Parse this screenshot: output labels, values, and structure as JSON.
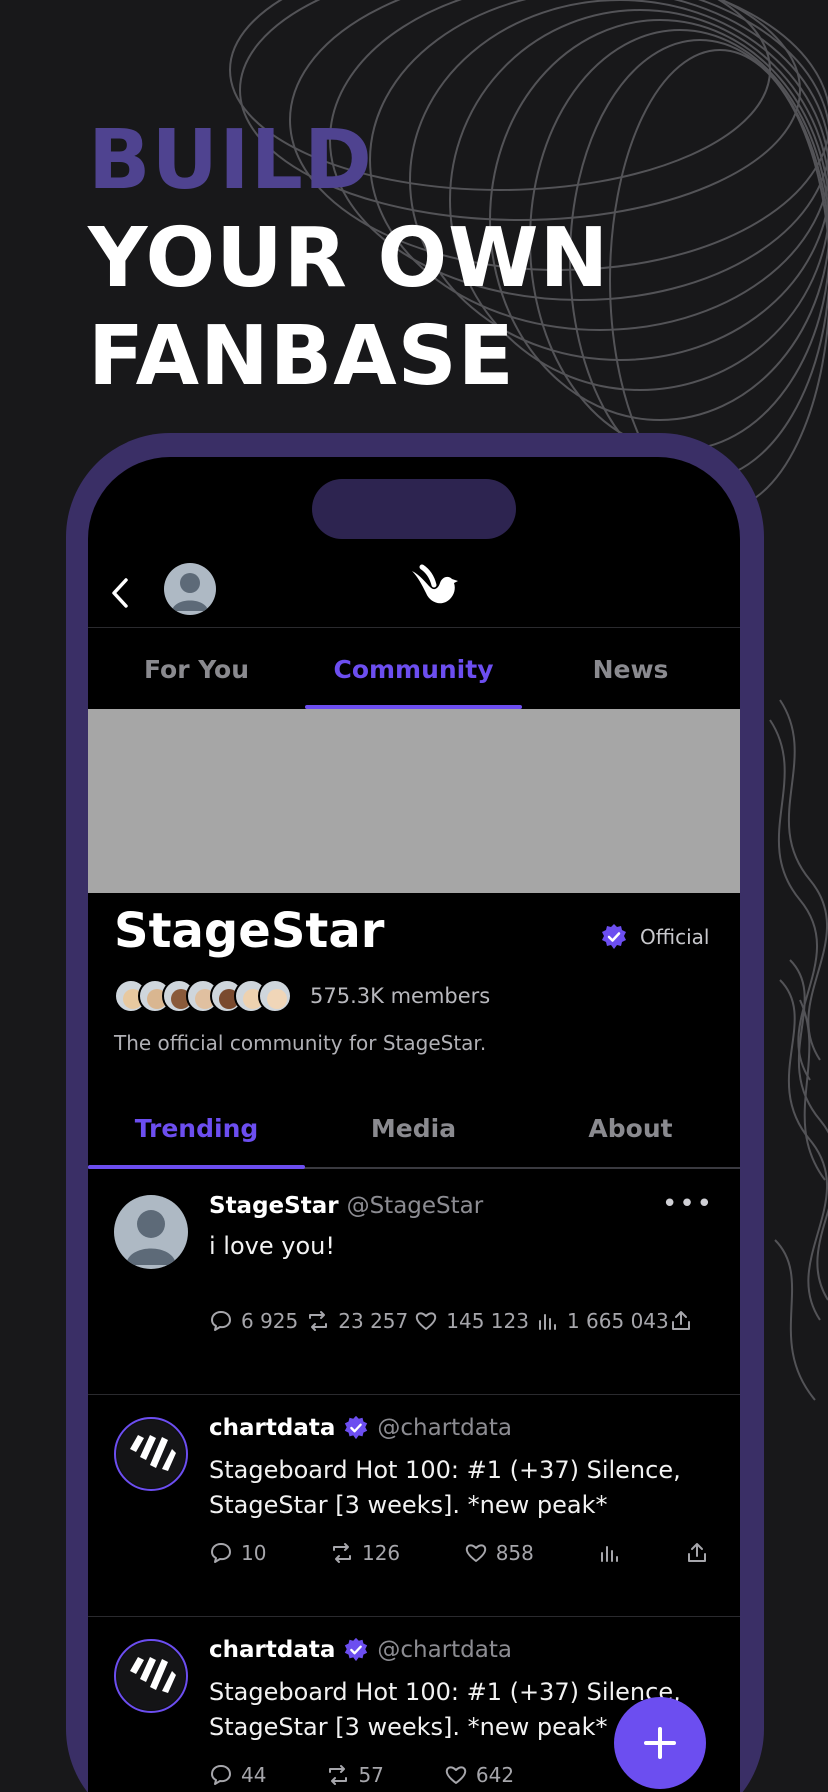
{
  "headline": {
    "line1": "BUILD",
    "line2": "YOUR OWN",
    "line3": "FANBASE"
  },
  "colors": {
    "accent": "#6c4ef0",
    "headline_accent": "#4f4390",
    "background": "#18181a",
    "phone_frame": "#3a2f66"
  },
  "top_tabs": [
    {
      "label": "For You",
      "active": false
    },
    {
      "label": "Community",
      "active": true
    },
    {
      "label": "News",
      "active": false
    }
  ],
  "community": {
    "name": "StageStar",
    "official_label": "Official",
    "members_label": "575.3K members",
    "description": "The official community for StageStar."
  },
  "community_tabs": [
    {
      "label": "Trending",
      "active": true
    },
    {
      "label": "Media",
      "active": false
    },
    {
      "label": "About",
      "active": false
    }
  ],
  "posts": [
    {
      "name": "StageStar",
      "handle": "@StageStar",
      "text": "i love you!",
      "replies": "6 925",
      "reposts": "23 257",
      "likes": "145 123",
      "views": "1 665 043",
      "more": "•••"
    },
    {
      "name": "chartdata",
      "handle": "@chartdata",
      "text": "Stageboard Hot 100: #1 (+37) Silence, StageStar [3 weeks]. *new peak*",
      "replies": "10",
      "reposts": "126",
      "likes": "858"
    },
    {
      "name": "chartdata",
      "handle": "@chartdata",
      "text": "Stageboard Hot 100: #1 (+37) Silence, StageStar [3 weeks]. *new peak*",
      "replies": "44",
      "reposts": "57",
      "likes": "642"
    }
  ],
  "icons": [
    "back-chevron-icon",
    "bird-logo-icon",
    "verified-badge-icon",
    "reply-icon",
    "repost-icon",
    "like-icon",
    "views-icon",
    "share-icon",
    "plus-icon"
  ]
}
